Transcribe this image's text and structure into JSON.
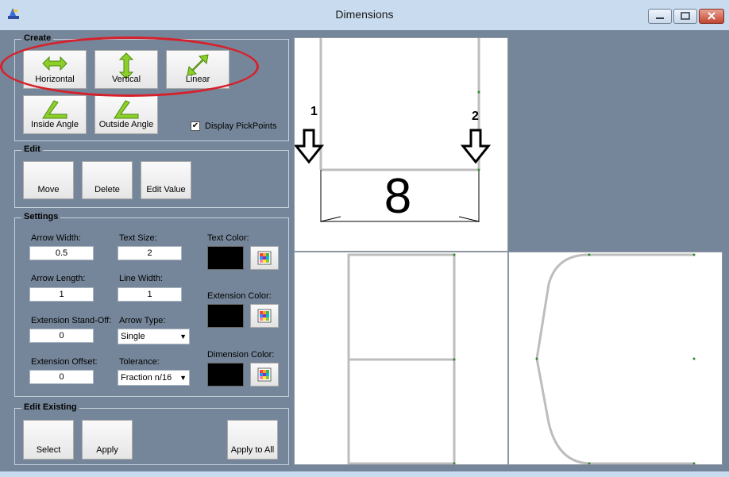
{
  "window": {
    "title": "Dimensions"
  },
  "create": {
    "group_label": "Create",
    "horizontal": "Horizontal",
    "vertical": "Vertical",
    "linear": "Linear",
    "inside_angle": "Inside Angle",
    "outside_angle": "Outside Angle",
    "display_pickpoints": "Display PickPoints",
    "display_pickpoints_checked": true
  },
  "edit": {
    "group_label": "Edit",
    "move": "Move",
    "delete": "Delete",
    "edit_value": "Edit Value"
  },
  "settings": {
    "group_label": "Settings",
    "arrow_width_label": "Arrow Width:",
    "arrow_width_value": "0.5",
    "text_size_label": "Text Size:",
    "text_size_value": "2",
    "arrow_length_label": "Arrow Length:",
    "arrow_length_value": "1",
    "line_width_label": "Line Width:",
    "line_width_value": "1",
    "ext_standoff_label": "Extension Stand-Off:",
    "ext_standoff_value": "0",
    "arrow_type_label": "Arrow Type:",
    "arrow_type_value": "Single",
    "ext_offset_label": "Extension Offset:",
    "ext_offset_value": "0",
    "tolerance_label": "Tolerance:",
    "tolerance_value": "Fraction n/16",
    "text_color_label": "Text Color:",
    "extension_color_label": "Extension Color:",
    "dimension_color_label": "Dimension Color:",
    "text_color": "#000000",
    "extension_color": "#000000",
    "dimension_color": "#000000"
  },
  "edit_existing": {
    "group_label": "Edit Existing",
    "select": "Select",
    "apply": "Apply",
    "apply_to_all": "Apply to All"
  },
  "viewport": {
    "dimension_value": "8",
    "pick_point_1": "1",
    "pick_point_2": "2"
  },
  "colors": {
    "accent_green": "#7fc31c",
    "highlight_red": "#d6212b"
  }
}
